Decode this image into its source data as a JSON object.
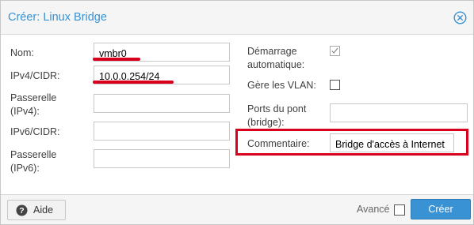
{
  "dialog": {
    "title": "Créer: Linux Bridge",
    "close_icon": "close-circle-icon"
  },
  "form": {
    "name": {
      "label": "Nom:",
      "value": "vmbr0"
    },
    "ipv4": {
      "label": "IPv4/CIDR:",
      "value": "10.0.0.254/24"
    },
    "gateway4": {
      "label_line1": "Passerelle",
      "label_line2": "(IPv4):",
      "value": ""
    },
    "ipv6": {
      "label": "IPv6/CIDR:",
      "value": ""
    },
    "gateway6": {
      "label_line1": "Passerelle",
      "label_line2": "(IPv6):",
      "value": ""
    },
    "autostart": {
      "label_line1": "Démarrage",
      "label_line2": "automatique:",
      "checked": true
    },
    "vlan_aware": {
      "label": "Gère les VLAN:",
      "checked": false
    },
    "bridge_ports": {
      "label_line1": "Ports du pont",
      "label_line2": "(bridge):",
      "value": ""
    },
    "comment": {
      "label": "Commentaire:",
      "value": "Bridge d'accès à Internet"
    }
  },
  "footer": {
    "help_label": "Aide",
    "help_icon": "question-circle-icon",
    "advanced_label": "Avancé",
    "advanced_checked": false,
    "create_label": "Créer"
  },
  "colors": {
    "accent": "#3892d4",
    "annotation_red": "#d8001c"
  }
}
